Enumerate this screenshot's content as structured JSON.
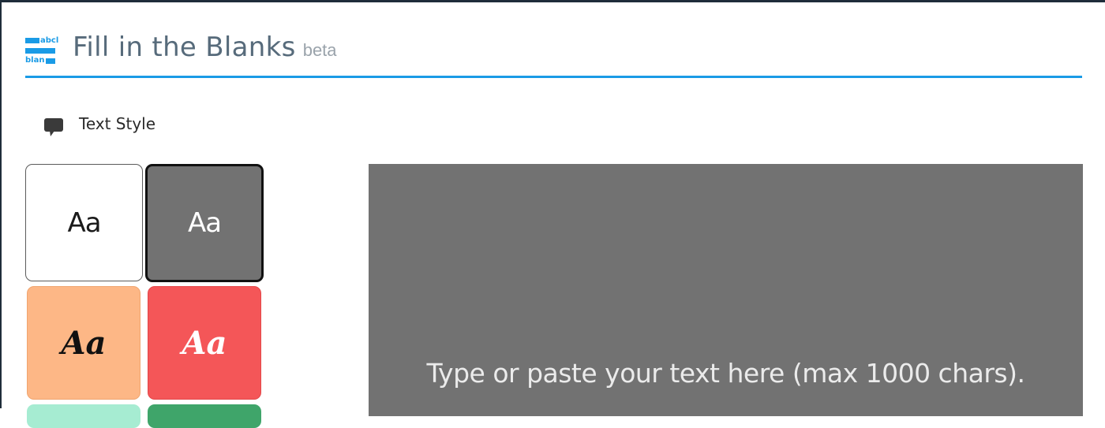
{
  "app": {
    "logo": {
      "line1": "abcl",
      "line2": "blan"
    },
    "title": "Fill in the Blanks",
    "badge": "beta",
    "accent_color": "#1a9be6"
  },
  "text_style_section": {
    "icon": "speech-bubble-icon",
    "label": "Text Style",
    "tiles": [
      {
        "label": "Aa",
        "style": "sans",
        "background": "#ffffff",
        "text_color": "#1a1a1a",
        "selected": false
      },
      {
        "label": "Aa",
        "style": "sans",
        "background": "#727272",
        "text_color": "#ffffff",
        "selected": true
      },
      {
        "label": "Aa",
        "style": "script",
        "background": "#fdb786",
        "text_color": "#111111",
        "selected": false
      },
      {
        "label": "Aa",
        "style": "script",
        "background": "#f45658",
        "text_color": "#ffffff",
        "selected": false
      },
      {
        "label": "",
        "style": "unknown",
        "background": "#a6ecd2",
        "selected": false
      },
      {
        "label": "",
        "style": "unknown",
        "background": "#3fa56a",
        "selected": false
      }
    ]
  },
  "editor": {
    "placeholder": "Type or paste your text here (max 1000 chars).",
    "background": "#727272"
  }
}
